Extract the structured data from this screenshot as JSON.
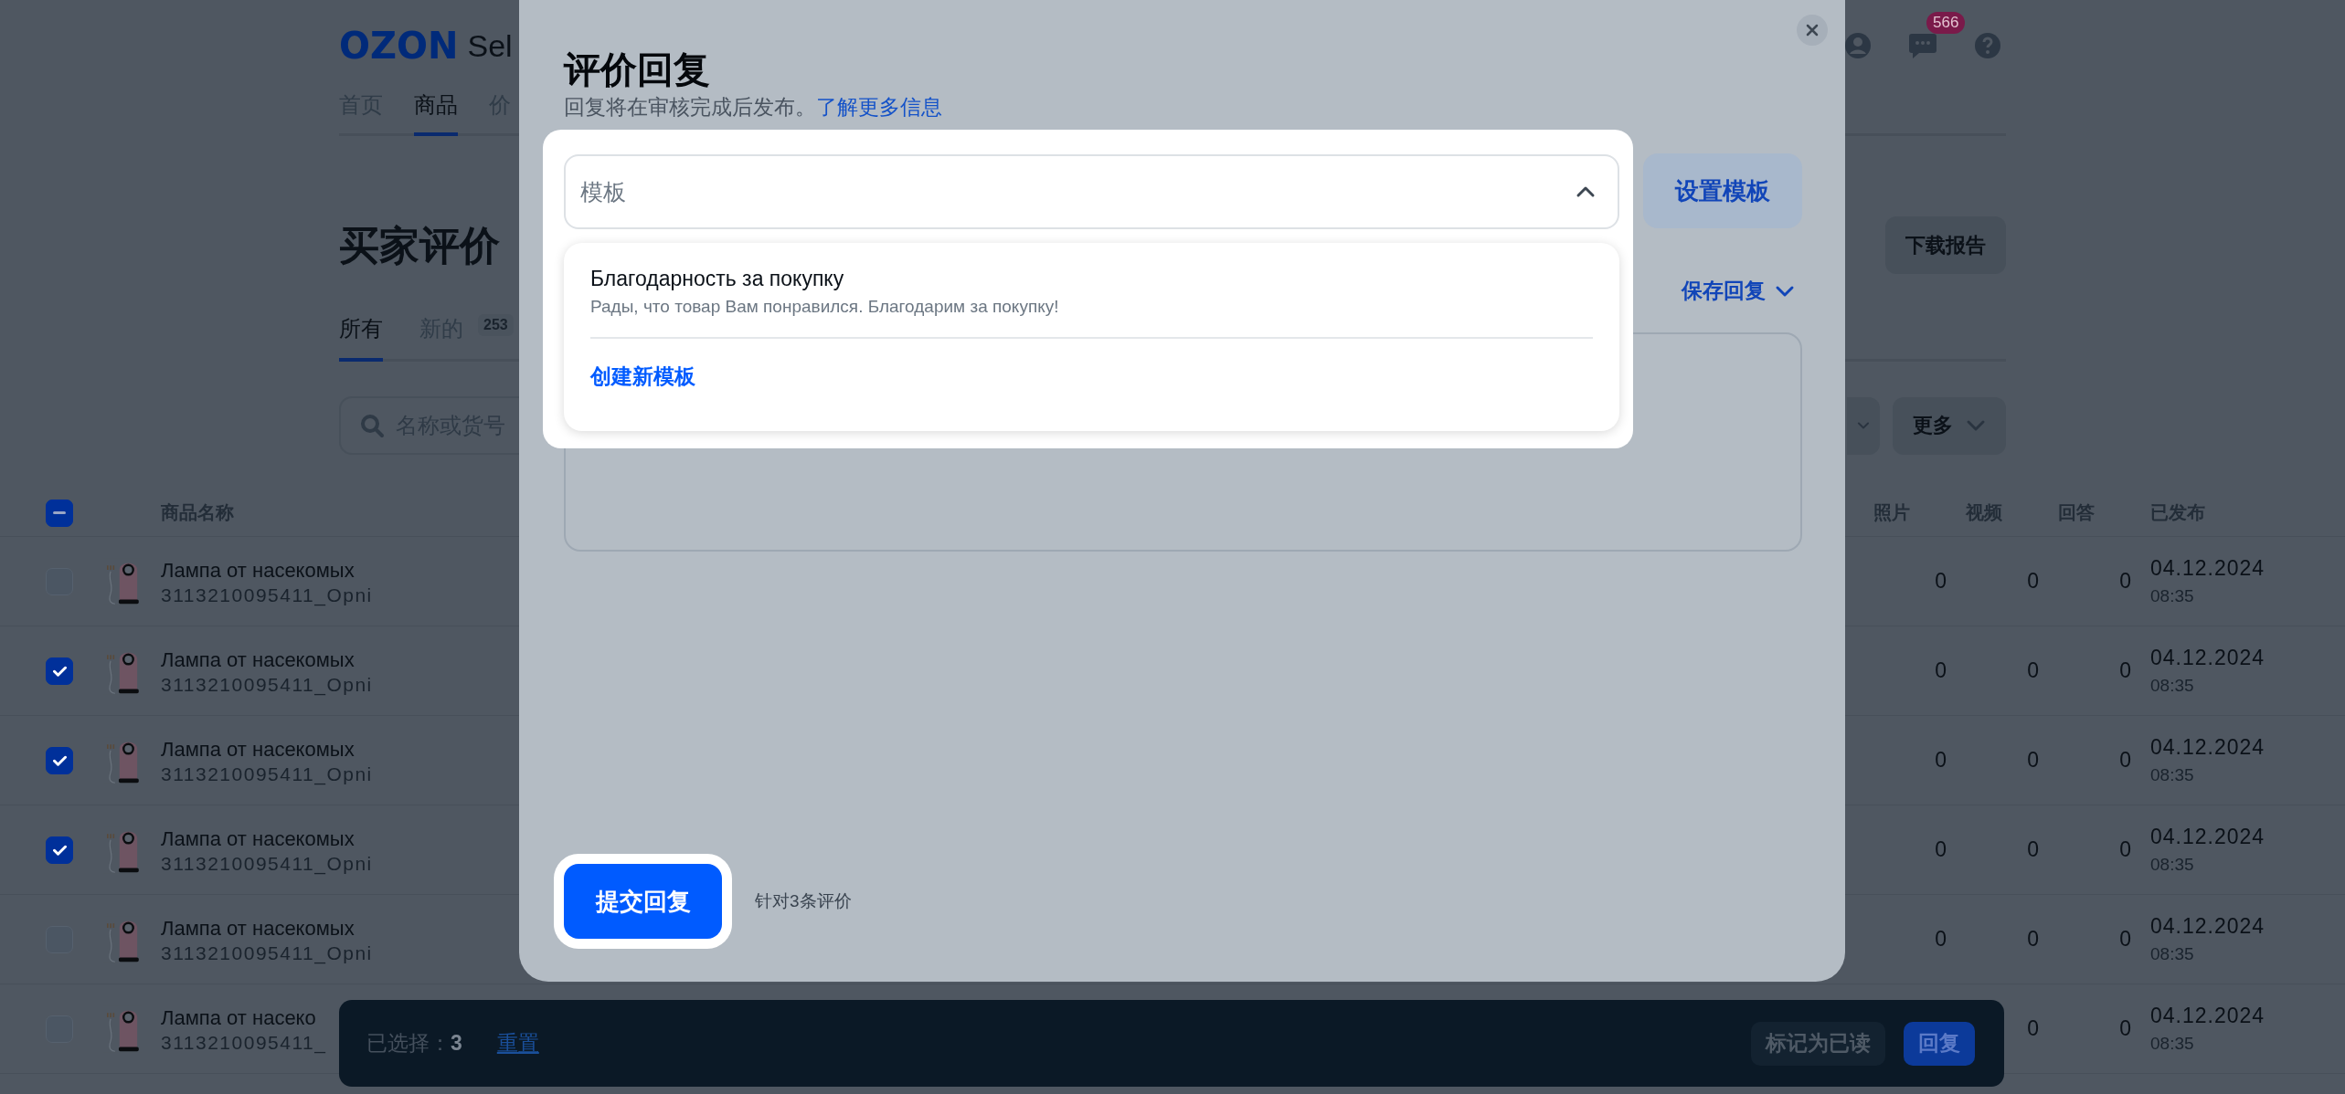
{
  "header": {
    "logo": "OZON",
    "logo_suffix": "Sel",
    "nav": [
      {
        "label": "首页",
        "selected": false
      },
      {
        "label": "商品",
        "selected": true
      },
      {
        "label": "价",
        "selected": false
      }
    ],
    "chat_badge": "566"
  },
  "page": {
    "title": "买家评价",
    "download_button": "下载报告",
    "tabs": [
      {
        "label": "所有",
        "selected": true
      },
      {
        "label": "新的",
        "count": "253",
        "selected": false
      }
    ],
    "search_placeholder": "名称或货号",
    "more_button": "更多"
  },
  "table": {
    "select_all_partial": true,
    "columns": [
      "商品名称",
      "照片",
      "视频",
      "回答",
      "已发布"
    ],
    "rows": [
      {
        "checked": false,
        "name": "Лампа от насекомых",
        "sku": "3113210095411_Opni",
        "photos": "0",
        "videos": "0",
        "answers": "0",
        "date": "04.12.2024",
        "time": "08:35"
      },
      {
        "checked": true,
        "name": "Лампа от насекомых",
        "sku": "3113210095411_Opni",
        "photos": "0",
        "videos": "0",
        "answers": "0",
        "date": "04.12.2024",
        "time": "08:35"
      },
      {
        "checked": true,
        "name": "Лампа от насекомых",
        "sku": "3113210095411_Opni",
        "photos": "0",
        "videos": "0",
        "answers": "0",
        "date": "04.12.2024",
        "time": "08:35"
      },
      {
        "checked": true,
        "name": "Лампа от насекомых",
        "sku": "3113210095411_Opni",
        "photos": "0",
        "videos": "0",
        "answers": "0",
        "date": "04.12.2024",
        "time": "08:35"
      },
      {
        "checked": false,
        "name": "Лампа от насекомых",
        "sku": "3113210095411_Opni",
        "photos": "0",
        "videos": "0",
        "answers": "0",
        "date": "04.12.2024",
        "time": "08:35"
      },
      {
        "checked": false,
        "name": "Лампа от насеко",
        "sku": "3113210095411_",
        "videos": "0",
        "answers": "0",
        "date": "04.12.2024",
        "time": "08:35"
      }
    ]
  },
  "modal": {
    "title": "评价回复",
    "subtitle": "回复将在审核完成后发布。",
    "learn_more": "了解更多信息",
    "template_field": {
      "placeholder": "模板",
      "expanded": true
    },
    "setup_button": "设置模板",
    "save_reply": "保存回复",
    "options": [
      {
        "title": "Благодарность за покупку",
        "description": "Рады, что товар Вам понравился. Благодарим за покупку!"
      }
    ],
    "create_template": "创建新模板",
    "submit_button": "提交回复",
    "submit_note": "针对3条评价"
  },
  "selection_bar": {
    "label": "已选择：",
    "count": "3",
    "reset": "重置",
    "mark_read": "标记为已读",
    "reply": "回复"
  }
}
